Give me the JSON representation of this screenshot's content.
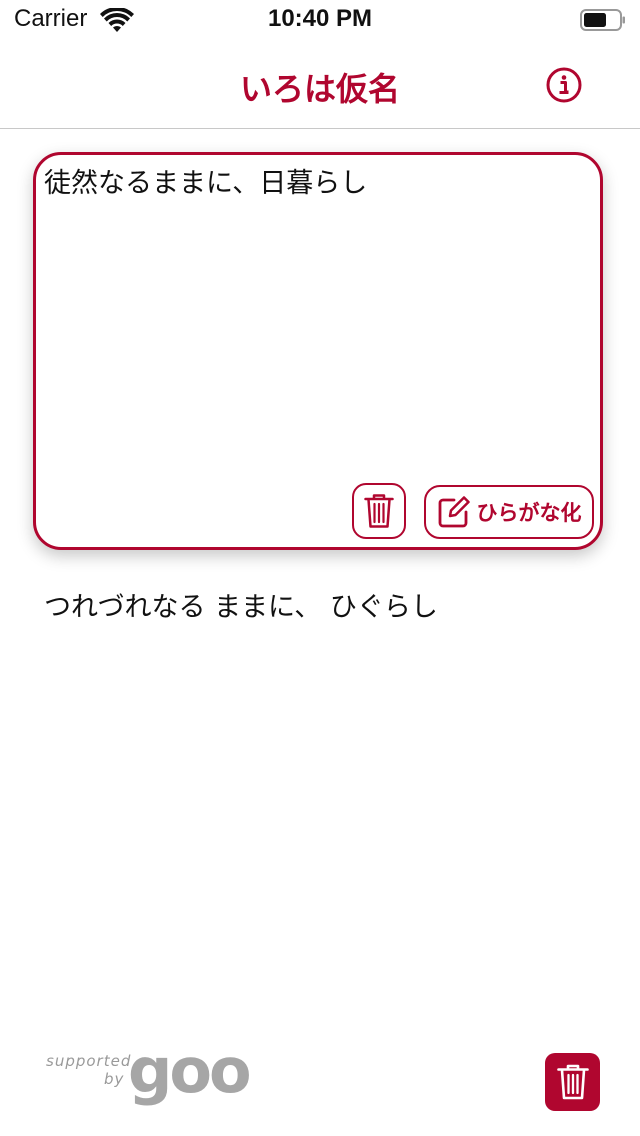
{
  "status_bar": {
    "carrier": "Carrier",
    "time": "10:40 PM"
  },
  "nav": {
    "title": "いろは仮名",
    "info_icon": "info-circle-icon"
  },
  "input_card": {
    "text": "徒然なるままに、日暮らし",
    "clear_icon": "trash-icon",
    "convert_icon": "edit-square-icon",
    "convert_label": "ひらがな化"
  },
  "result": {
    "text": "つれづれなる ままに、 ひぐらし"
  },
  "footer": {
    "supported": "supported",
    "by": "by",
    "logo": "goo",
    "trash_icon": "trash-icon"
  },
  "colors": {
    "accent": "#b0062f",
    "logo_gray": "#a6a6a6"
  }
}
